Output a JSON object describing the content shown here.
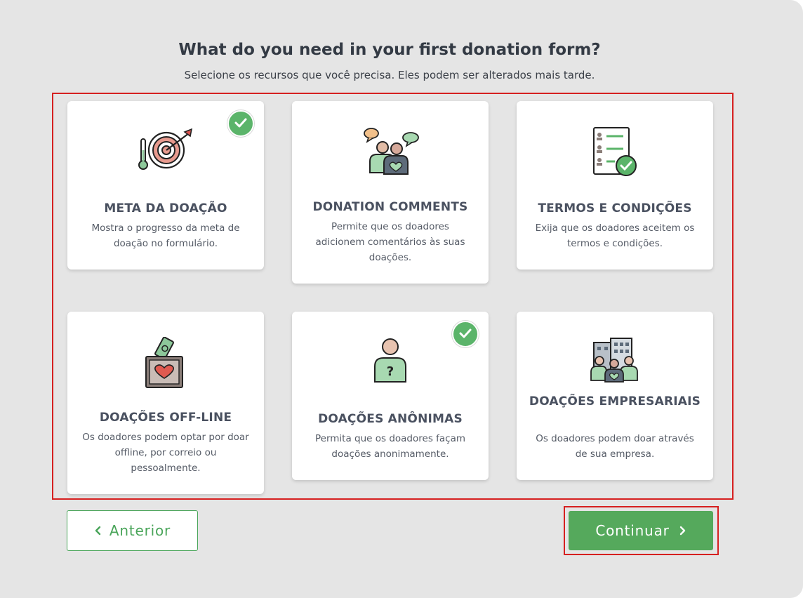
{
  "header": {
    "title": "What do you need in your first donation form?",
    "subtitle": "Selecione os recursos que você precisa. Eles podem ser alterados mais tarde."
  },
  "cards": [
    {
      "title": "META DA DOAÇÃO",
      "description": "Mostra o progresso da meta de doação no formulário.",
      "selected": true,
      "icon": "target-goal-icon"
    },
    {
      "title": "DONATION COMMENTS",
      "description": "Permite que os doadores adicionem comentários às suas doações.",
      "selected": false,
      "icon": "comments-people-icon"
    },
    {
      "title": "TERMOS E CONDIÇÕES",
      "description": "Exija que os doadores aceitem os termos e condições.",
      "selected": false,
      "icon": "terms-checklist-icon"
    },
    {
      "title": "DOAÇÕES OFF-LINE",
      "description": "Os doadores podem optar por doar offline, por correio ou pessoalmente.",
      "selected": false,
      "icon": "offline-donation-box-icon"
    },
    {
      "title": "DOAÇÕES ANÔNIMAS",
      "description": "Permita que os doadores façam doações anonimamente.",
      "selected": true,
      "icon": "anonymous-donor-icon"
    },
    {
      "title": "DOAÇÕES EMPRESARIAIS",
      "description": "Os doadores podem doar através de sua empresa.",
      "selected": false,
      "icon": "company-buildings-icon"
    }
  ],
  "buttons": {
    "previous": "Anterior",
    "next": "Continuar"
  },
  "colors": {
    "accent_green": "#55a95c",
    "check_green": "#5bb46a",
    "highlight_red": "#d62020",
    "background": "#e5e5e5"
  }
}
